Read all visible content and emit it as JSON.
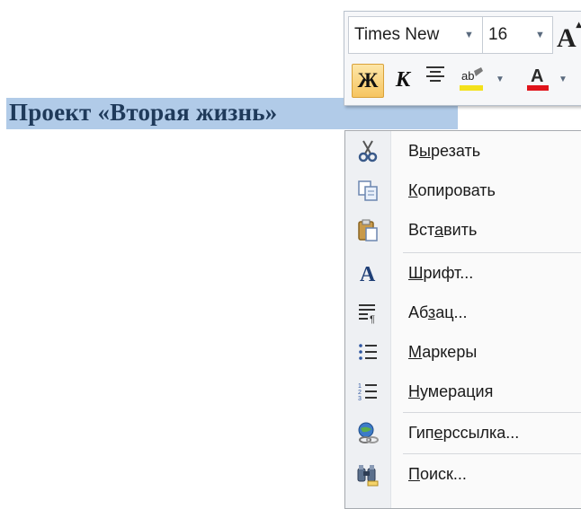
{
  "document": {
    "title": "Проект «Вторая жизнь»"
  },
  "mini_toolbar": {
    "font_name": "Times New",
    "font_size": "16",
    "grow_font_icon": "grow-font-icon",
    "grow_font_glyph": "A",
    "bold_glyph": "Ж",
    "italic_glyph": "К",
    "highlight_glyph": "ab",
    "font_color_glyph": "A",
    "highlight_color": "#f3e11b",
    "font_color": "#e0141b"
  },
  "context_menu": {
    "items": [
      {
        "pre": "В",
        "acc": "ы",
        "post": "резать",
        "icon": "scissors-icon"
      },
      {
        "pre": "",
        "acc": "К",
        "post": "опировать",
        "icon": "copy-icon"
      },
      {
        "pre": "Вст",
        "acc": "а",
        "post": "вить",
        "icon": "paste-icon"
      },
      {
        "pre": "",
        "acc": "Ш",
        "post": "рифт...",
        "icon": "font-icon"
      },
      {
        "pre": "Аб",
        "acc": "з",
        "post": "ац...",
        "icon": "paragraph-icon"
      },
      {
        "pre": "",
        "acc": "М",
        "post": "аркеры",
        "icon": "bullets-icon"
      },
      {
        "pre": "",
        "acc": "Н",
        "post": "умерация",
        "icon": "numbering-icon"
      },
      {
        "pre": "Гип",
        "acc": "е",
        "post": "рссылка...",
        "icon": "hyperlink-icon"
      },
      {
        "pre": "",
        "acc": "П",
        "post": "оиск...",
        "icon": "search-icon"
      }
    ]
  }
}
